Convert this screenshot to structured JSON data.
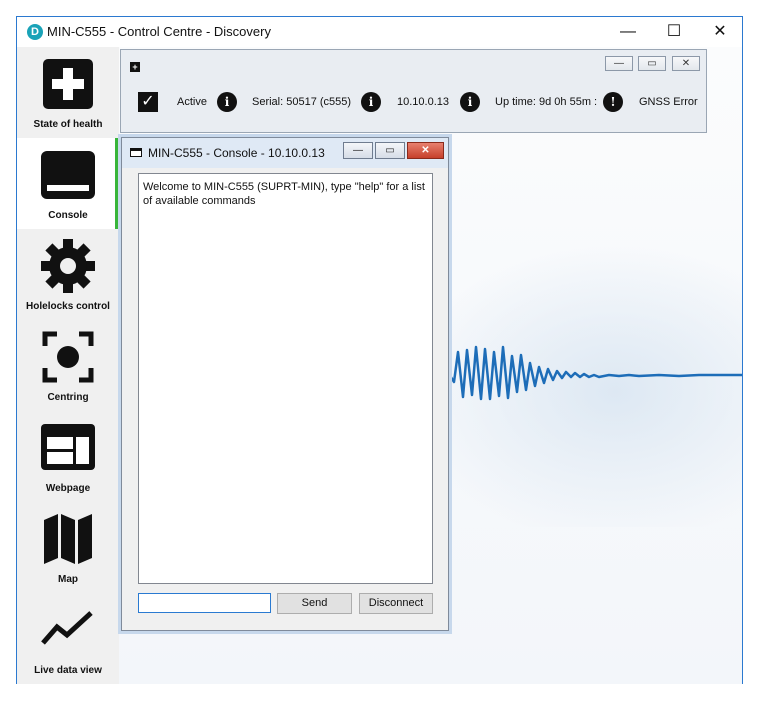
{
  "window": {
    "title": "MIN-C555 - Control Centre - Discovery",
    "app_icon_glyph": "D",
    "controls": {
      "minimize": "—",
      "maximize": "☐",
      "close": "✕"
    }
  },
  "sidebar": {
    "accent_color": "#38b53a",
    "items": [
      {
        "label": "State of health",
        "icon": "first-aid-icon"
      },
      {
        "label": "Console",
        "icon": "console-icon",
        "active": true
      },
      {
        "label": "Holelocks control",
        "icon": "gear-icon"
      },
      {
        "label": "Centring",
        "icon": "centring-target-icon"
      },
      {
        "label": "Webpage",
        "icon": "webpage-icon"
      },
      {
        "label": "Map",
        "icon": "map-icon"
      },
      {
        "label": "Live data view",
        "icon": "line-chart-icon"
      }
    ]
  },
  "status_panel": {
    "add_glyph": "+",
    "buttons": {
      "minimize": "—",
      "restore": "▭",
      "close": "✕"
    },
    "active_label": "Active",
    "serial_label": "Serial: 50517 (c555)",
    "ip_label": "10.10.0.13",
    "uptime_label": "Up time: 9d 0h 55m :",
    "gnss_label": "GNSS Error",
    "info_glyph": "i",
    "warning_glyph": "!",
    "check_glyph": "✓"
  },
  "console": {
    "title": "MIN-C555 - Console - 10.10.0.13",
    "buttons": {
      "minimize": "—",
      "restore": "▭",
      "close": "✕"
    },
    "output": "Welcome to MIN-C555 (SUPRT-MIN), type \"help\" for a list of available commands",
    "input_value": "",
    "send_label": "Send",
    "disconnect_label": "Disconnect"
  }
}
